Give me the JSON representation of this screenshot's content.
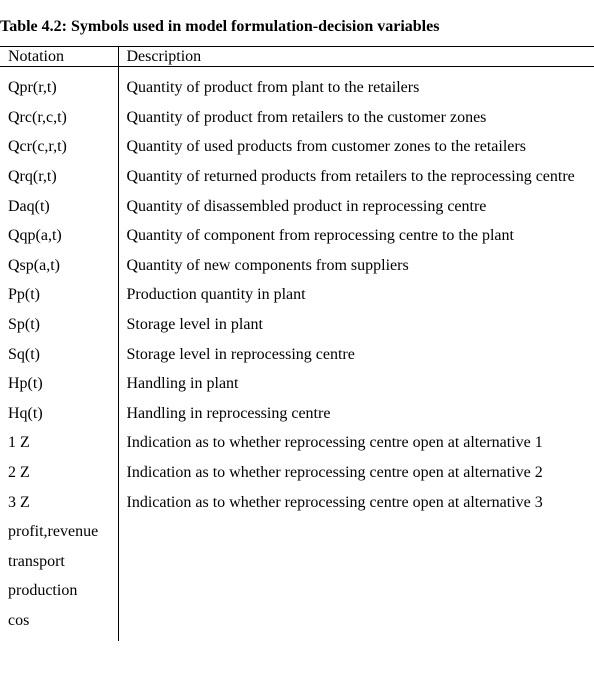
{
  "caption": "Table 4.2: Symbols used in model formulation-decision variables",
  "headers": {
    "notation": "Notation",
    "description": "Description"
  },
  "rows": [
    {
      "notation": "Qpr(r,t)",
      "description": "Quantity of product from plant to the retailers"
    },
    {
      "notation": "Qrc(r,c,t)",
      "description": "Quantity of product from retailers to the customer zones"
    },
    {
      "notation": "Qcr(c,r,t)",
      "description": "Quantity of used products from customer zones to the retailers"
    },
    {
      "notation": "Qrq(r,t)",
      "description": "Quantity of returned products from retailers to the reprocessing centre"
    },
    {
      "notation": "Daq(t)",
      "description": "Quantity of disassembled product in reprocessing centre"
    },
    {
      "notation": "Qqp(a,t)",
      "description": "Quantity of component from reprocessing centre to the plant"
    },
    {
      "notation": "Qsp(a,t)",
      "description": "Quantity of new components from suppliers"
    },
    {
      "notation": "Pp(t)",
      "description": "Production quantity in plant"
    },
    {
      "notation": "Sp(t)",
      "description": "Storage level in plant"
    },
    {
      "notation": "Sq(t)",
      "description": "Storage level in reprocessing centre"
    },
    {
      "notation": "Hp(t)",
      "description": "Handling in plant"
    },
    {
      "notation": "Hq(t)",
      "description": "Handling in reprocessing centre"
    },
    {
      "notation": "1 Z",
      "description": "Indication as to whether reprocessing centre open at alternative 1"
    },
    {
      "notation": "2 Z",
      "description": "Indication as to whether reprocessing centre open at alternative 2"
    },
    {
      "notation": "3 Z",
      "description": "Indication as to whether reprocessing centre open at alternative 3"
    },
    {
      "notation": "profit,revenue",
      "description": ""
    },
    {
      "notation": "transport",
      "description": ""
    },
    {
      "notation": "production",
      "description": ""
    },
    {
      "notation": "cos",
      "description": ""
    }
  ]
}
